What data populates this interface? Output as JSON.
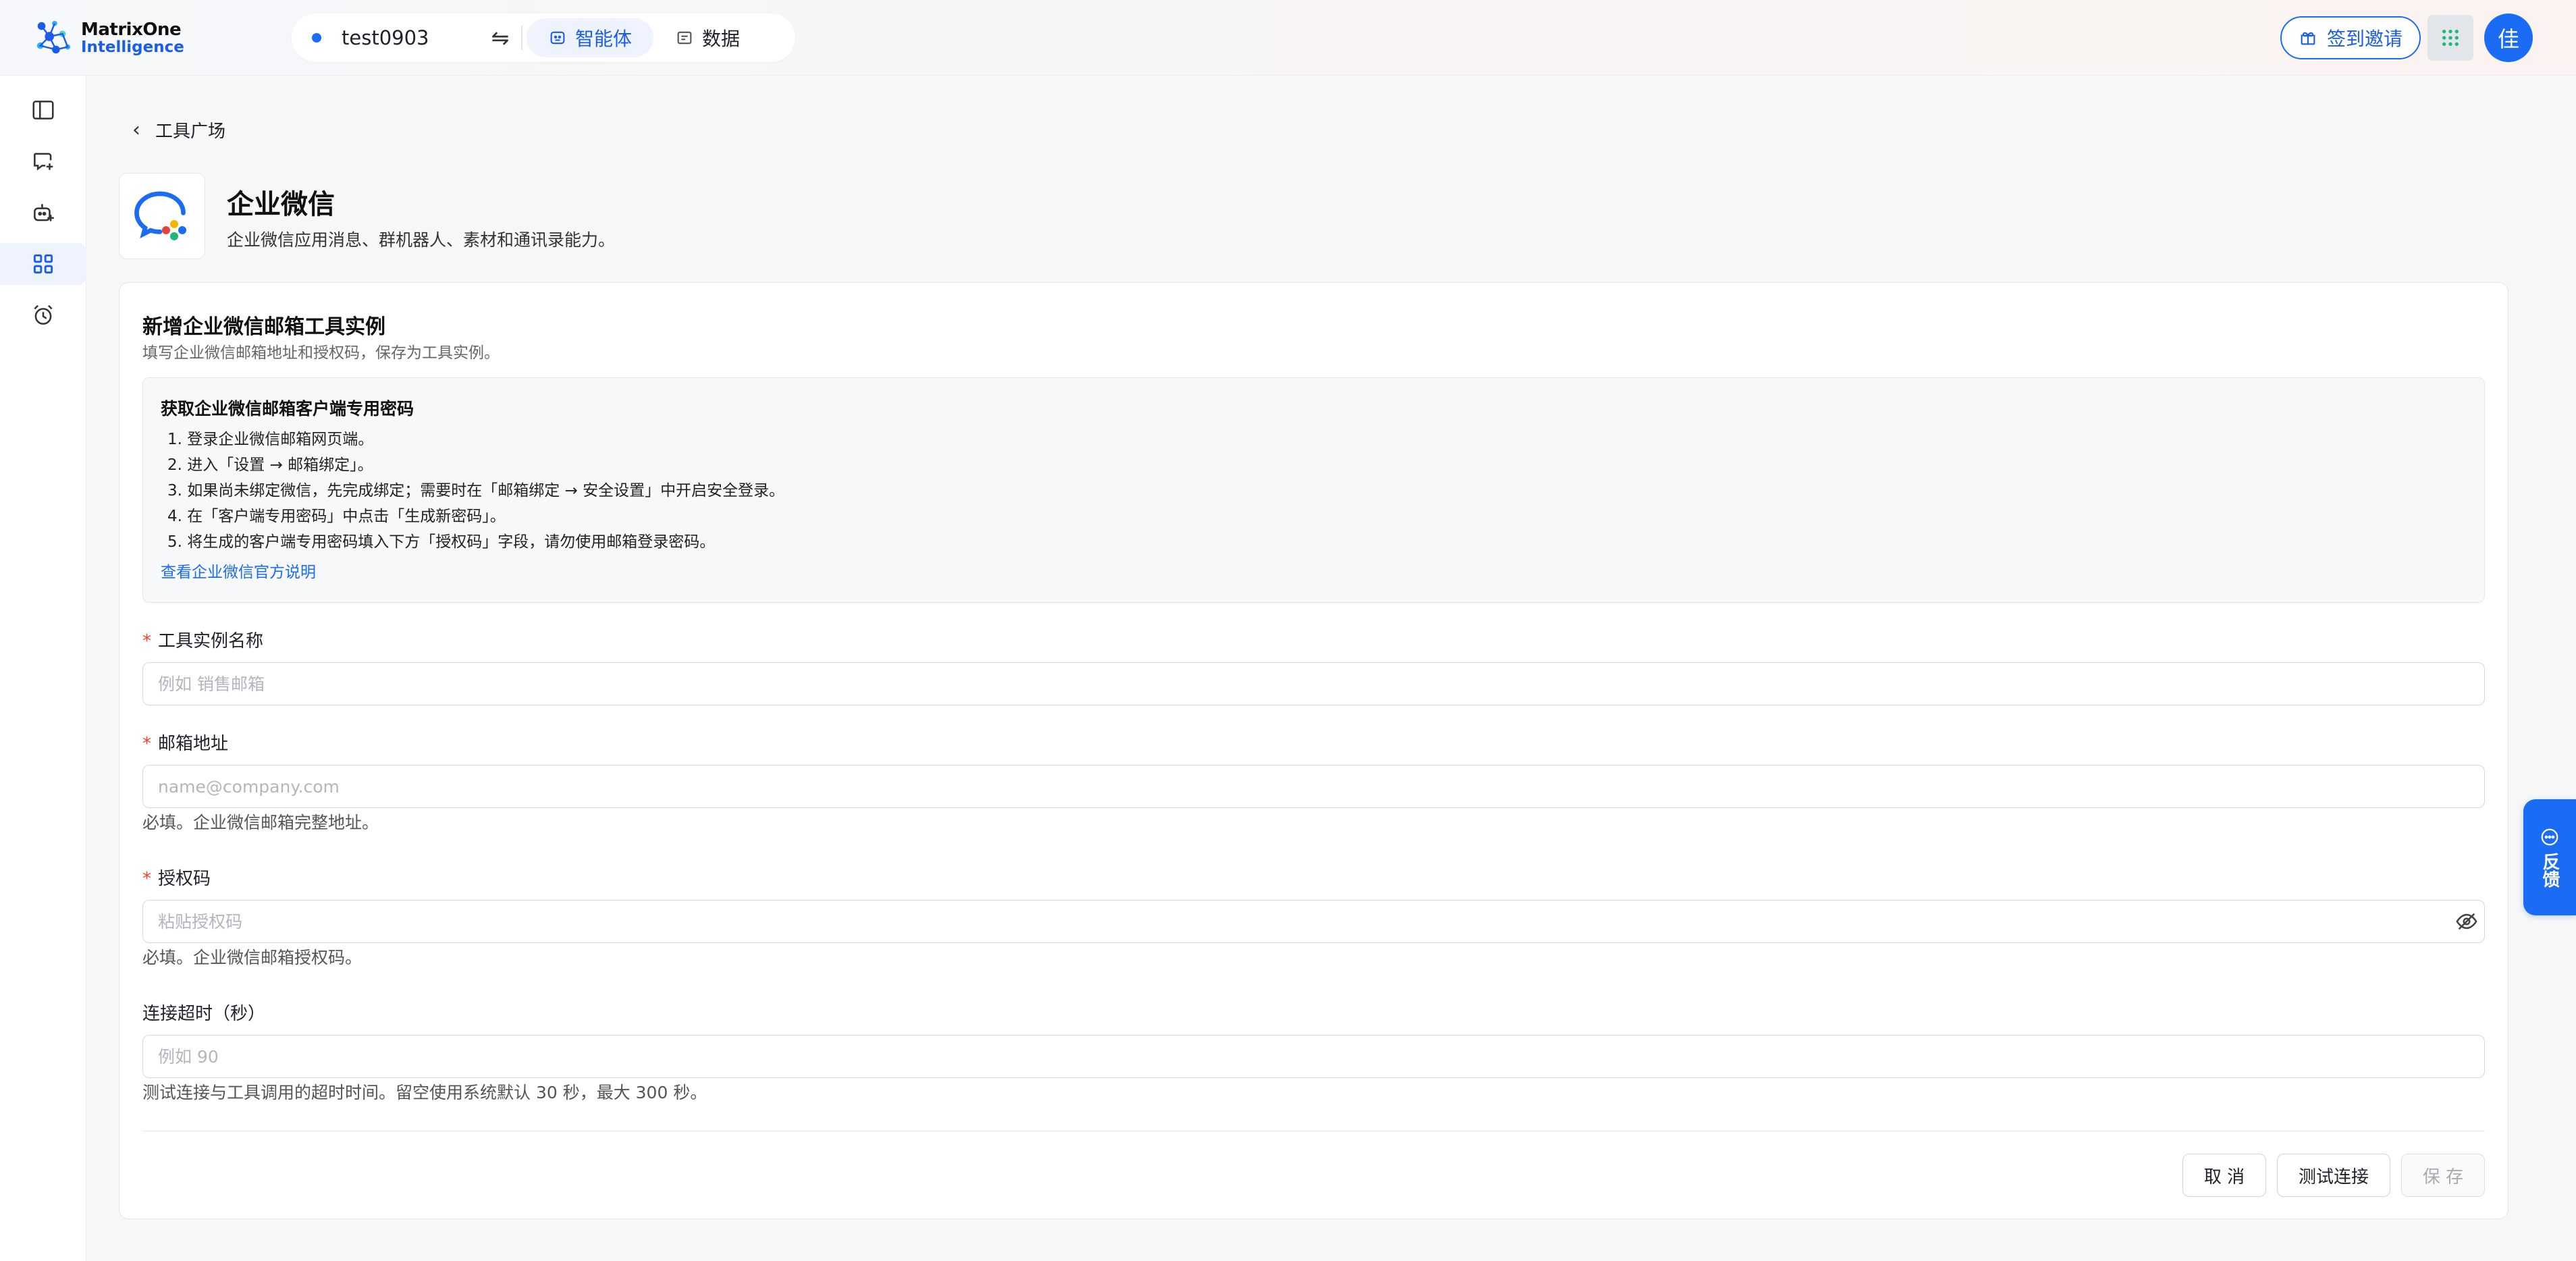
{
  "brand": {
    "line1": "MatrixOne",
    "line2": "Intelligence"
  },
  "workspace": {
    "name": "test0903"
  },
  "mode_tabs": [
    {
      "label": "智能体",
      "active": true
    },
    {
      "label": "数据",
      "active": false
    }
  ],
  "header": {
    "invite_label": "签到邀请",
    "avatar_text": "佳"
  },
  "breadcrumb": {
    "back_label": "工具广场"
  },
  "tool": {
    "name": "企业微信",
    "description": "企业微信应用消息、群机器人、素材和通讯录能力。"
  },
  "form": {
    "title": "新增企业微信邮箱工具实例",
    "subtitle": "填写企业微信邮箱地址和授权码，保存为工具实例。",
    "guide": {
      "title": "获取企业微信邮箱客户端专用密码",
      "steps": [
        "1. 登录企业微信邮箱网页端。",
        "2. 进入「设置 → 邮箱绑定」。",
        "3. 如果尚未绑定微信，先完成绑定；需要时在「邮箱绑定 → 安全设置」中开启安全登录。",
        "4. 在「客户端专用密码」中点击「生成新密码」。",
        "5. 将生成的客户端专用密码填入下方「授权码」字段，请勿使用邮箱登录密码。"
      ],
      "link_label": "查看企业微信官方说明"
    },
    "fields": {
      "name": {
        "required_mark": "*",
        "label": "工具实例名称",
        "placeholder": "例如 销售邮箱"
      },
      "email": {
        "required_mark": "*",
        "label": "邮箱地址",
        "placeholder": "name@company.com",
        "help": "必填。企业微信邮箱完整地址。"
      },
      "auth_code": {
        "required_mark": "*",
        "label": "授权码",
        "placeholder": "粘贴授权码",
        "help": "必填。企业微信邮箱授权码。"
      },
      "timeout": {
        "label": "连接超时（秒）",
        "placeholder": "例如 90",
        "help": "测试连接与工具调用的超时时间。留空使用系统默认 30 秒，最大 300 秒。"
      }
    },
    "buttons": {
      "cancel": "取 消",
      "test": "测试连接",
      "save": "保 存"
    }
  },
  "feedback": {
    "label": "反馈"
  },
  "colors": {
    "accent": "#1a6cf4",
    "required": "#f5412d"
  }
}
